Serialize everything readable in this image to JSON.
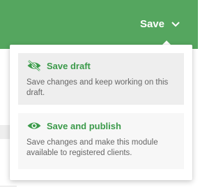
{
  "header": {
    "save_label": "Save",
    "chevron_icon": "chevron-down-icon"
  },
  "dropdown": {
    "options": [
      {
        "icon": "eye-off-icon",
        "title": "Save draft",
        "description": "Save changes and keep working on this draft."
      },
      {
        "icon": "eye-icon",
        "title": "Save and publish",
        "description": "Save changes and make this module available to registered clients."
      }
    ]
  },
  "colors": {
    "header_bg": "#55a65f",
    "accent": "#3b9a4a",
    "text_muted": "#666666"
  }
}
